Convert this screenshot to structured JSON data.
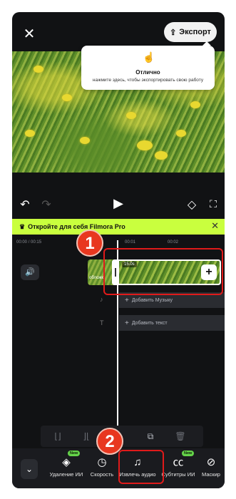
{
  "header": {
    "close_icon": "close-icon",
    "export_label": "Экспорт",
    "export_icon": "upload-icon"
  },
  "tooltip": {
    "title": "Отлично",
    "text": "нажмите здесь, чтобы экспортировать свою работу"
  },
  "controls": {
    "undo": "undo-icon",
    "redo": "redo-icon",
    "play": "play-icon",
    "keyframe": "keyframe-icon",
    "fullscreen": "fullscreen-icon"
  },
  "promo": {
    "text": "Откройте для себя Filmora Pro"
  },
  "timeline": {
    "current_time": "00:00",
    "total_time": "/ 00:15",
    "tick_1": "00:01",
    "tick_2": "00:02",
    "clip_duration": "15.0s",
    "clip_thumb_label": "обложк",
    "add_music": "Добавить Музыку",
    "add_text": "Добавить текст"
  },
  "toolbar": {
    "new_badge": "New",
    "items": [
      {
        "label": "Удаление ИИ"
      },
      {
        "label": "Скорость"
      },
      {
        "label": "Извлечь аудио"
      },
      {
        "label": "Субтитры ИИ"
      },
      {
        "label": "Маскир"
      }
    ]
  },
  "annotations": {
    "step1": "1",
    "step2": "2",
    "highlight_color": "#e01a1a"
  },
  "colors": {
    "accent_lime": "#c9ff3e",
    "background": "#111214"
  }
}
